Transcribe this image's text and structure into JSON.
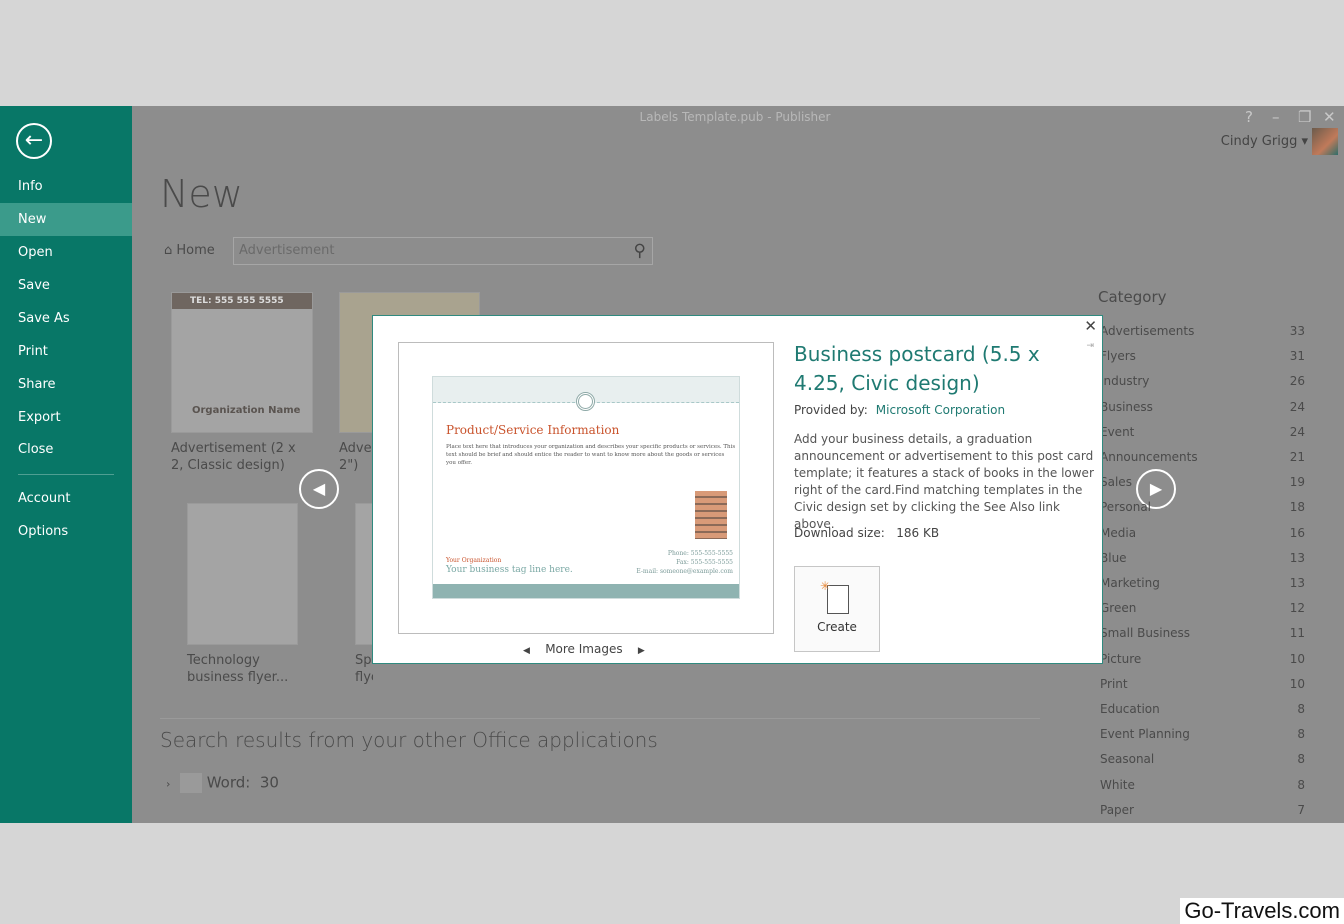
{
  "window": {
    "title": "Labels Template.pub - Publisher",
    "user": "Cindy Grigg"
  },
  "sidebar": {
    "items": [
      {
        "label": "Info"
      },
      {
        "label": "New"
      },
      {
        "label": "Open"
      },
      {
        "label": "Save"
      },
      {
        "label": "Save As"
      },
      {
        "label": "Print"
      },
      {
        "label": "Share"
      },
      {
        "label": "Export"
      },
      {
        "label": "Close"
      },
      {
        "label": "Account"
      },
      {
        "label": "Options"
      }
    ],
    "selected": "New"
  },
  "main": {
    "title": "New",
    "home": "Home",
    "search_value": "Advertisement",
    "templates": [
      {
        "label": "Advertisement (2 x 2, Classic design)"
      },
      {
        "label": "Adver 2\")"
      },
      {
        "label": "Technology business flyer..."
      },
      {
        "label": "Spr flyer"
      }
    ],
    "thumb_text": {
      "tel": "TEL: 555 555 5555",
      "org": "Organization Name"
    },
    "other_results": "Search results from your other Office applications",
    "word_label": "Word:",
    "word_count": "30"
  },
  "category": {
    "heading": "Category",
    "items": [
      {
        "name": "Advertisements",
        "count": "33"
      },
      {
        "name": "Flyers",
        "count": "31"
      },
      {
        "name": "Industry",
        "count": "26"
      },
      {
        "name": "Business",
        "count": "24"
      },
      {
        "name": "Event",
        "count": "24"
      },
      {
        "name": "Announcements",
        "count": "21"
      },
      {
        "name": "Sales",
        "count": "19"
      },
      {
        "name": "Personal",
        "count": "18"
      },
      {
        "name": "Media",
        "count": "16"
      },
      {
        "name": "Blue",
        "count": "13"
      },
      {
        "name": "Marketing",
        "count": "13"
      },
      {
        "name": "Green",
        "count": "12"
      },
      {
        "name": "Small Business",
        "count": "11"
      },
      {
        "name": "Picture",
        "count": "10"
      },
      {
        "name": "Print",
        "count": "10"
      },
      {
        "name": "Education",
        "count": "8"
      },
      {
        "name": "Event Planning",
        "count": "8"
      },
      {
        "name": "Seasonal",
        "count": "8"
      },
      {
        "name": "White",
        "count": "8"
      },
      {
        "name": "Paper",
        "count": "7"
      }
    ]
  },
  "dialog": {
    "title": "Business postcard (5.5 x 4.25, Civic design)",
    "provided_label": "Provided by:",
    "provider": "Microsoft Corporation",
    "description": "Add your business details, a graduation announcement or advertisement to this post card template; it features a stack of books in the lower right of the card.Find matching templates in the Civic design set by clicking the See Also link above.",
    "download_label": "Download size:",
    "download_size": "186 KB",
    "create_label": "Create",
    "more_images": "More Images",
    "card": {
      "title": "Product/Service Information",
      "body": "Place text here that introduces your organization and describes your specific products or services. This text should be brief and should entice the reader to want to know more about the goods or services you offer.",
      "org": "Your Organization",
      "tagline": "Your business tag line here.",
      "phone": "Phone: 555-555-5555",
      "fax": "Fax: 555-555-5555",
      "email": "E-mail: someone@example.com"
    }
  },
  "watermark": "Go-Travels.com",
  "colors": {
    "sidebar": "#087767",
    "accent": "#1f7a72",
    "card_accent": "#c9532c"
  }
}
